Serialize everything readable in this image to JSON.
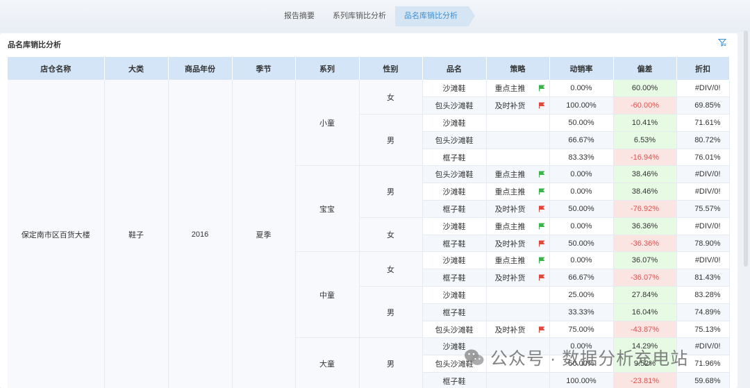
{
  "tabs": [
    {
      "label": "报告摘要",
      "active": false
    },
    {
      "label": "系列库销比分析",
      "active": false
    },
    {
      "label": "品名库销比分析",
      "active": true
    }
  ],
  "panel": {
    "title": "品名库销比分析"
  },
  "columns": [
    "店仓名称",
    "大类",
    "商品年份",
    "季节",
    "系列",
    "性别",
    "品名",
    "策略",
    "动销率",
    "偏差",
    "折扣"
  ],
  "group": {
    "store": "保定南市区百货大楼",
    "category": "鞋子",
    "year": "2016",
    "season": "夏季"
  },
  "series": [
    {
      "name": "小童",
      "genders": [
        {
          "name": "女",
          "rows": [
            {
              "product": "沙滩鞋",
              "strategy": "重点主推",
              "flag": "green",
              "rate": "0.00%",
              "deviation": "60.00%",
              "dev_sign": "pos",
              "discount": "#DIV/0!"
            },
            {
              "product": "包头沙滩鞋",
              "strategy": "及时补货",
              "flag": "red",
              "rate": "100.00%",
              "deviation": "-60.00%",
              "dev_sign": "neg",
              "discount": "69.85%"
            }
          ]
        },
        {
          "name": "男",
          "rows": [
            {
              "product": "沙滩鞋",
              "strategy": "",
              "flag": "",
              "rate": "50.00%",
              "deviation": "10.41%",
              "dev_sign": "pos",
              "discount": "71.61%"
            },
            {
              "product": "包头沙滩鞋",
              "strategy": "",
              "flag": "",
              "rate": "66.67%",
              "deviation": "6.53%",
              "dev_sign": "pos",
              "discount": "80.72%"
            },
            {
              "product": "框子鞋",
              "strategy": "",
              "flag": "",
              "rate": "83.33%",
              "deviation": "-16.94%",
              "dev_sign": "neg",
              "discount": "76.01%"
            }
          ]
        }
      ]
    },
    {
      "name": "宝宝",
      "genders": [
        {
          "name": "男",
          "rows": [
            {
              "product": "包头沙滩鞋",
              "strategy": "重点主推",
              "flag": "green",
              "rate": "0.00%",
              "deviation": "38.46%",
              "dev_sign": "pos",
              "discount": "#DIV/0!"
            },
            {
              "product": "沙滩鞋",
              "strategy": "重点主推",
              "flag": "green",
              "rate": "0.00%",
              "deviation": "38.46%",
              "dev_sign": "pos",
              "discount": "#DIV/0!"
            },
            {
              "product": "框子鞋",
              "strategy": "及时补货",
              "flag": "red",
              "rate": "50.00%",
              "deviation": "-76.92%",
              "dev_sign": "neg",
              "discount": "75.57%"
            }
          ]
        },
        {
          "name": "女",
          "rows": [
            {
              "product": "沙滩鞋",
              "strategy": "重点主推",
              "flag": "green",
              "rate": "0.00%",
              "deviation": "36.36%",
              "dev_sign": "pos",
              "discount": "#DIV/0!"
            },
            {
              "product": "框子鞋",
              "strategy": "及时补货",
              "flag": "red",
              "rate": "50.00%",
              "deviation": "-36.36%",
              "dev_sign": "neg",
              "discount": "78.90%"
            }
          ]
        }
      ]
    },
    {
      "name": "中童",
      "genders": [
        {
          "name": "女",
          "rows": [
            {
              "product": "沙滩鞋",
              "strategy": "重点主推",
              "flag": "green",
              "rate": "0.00%",
              "deviation": "36.07%",
              "dev_sign": "pos",
              "discount": "#DIV/0!"
            },
            {
              "product": "框子鞋",
              "strategy": "及时补货",
              "flag": "red",
              "rate": "66.67%",
              "deviation": "-36.07%",
              "dev_sign": "neg",
              "discount": "81.43%"
            }
          ]
        },
        {
          "name": "男",
          "rows": [
            {
              "product": "沙滩鞋",
              "strategy": "",
              "flag": "",
              "rate": "25.00%",
              "deviation": "27.84%",
              "dev_sign": "pos",
              "discount": "83.28%"
            },
            {
              "product": "框子鞋",
              "strategy": "",
              "flag": "",
              "rate": "33.33%",
              "deviation": "16.04%",
              "dev_sign": "pos",
              "discount": "74.89%"
            },
            {
              "product": "包头沙滩鞋",
              "strategy": "及时补货",
              "flag": "red",
              "rate": "75.00%",
              "deviation": "-43.87%",
              "dev_sign": "neg",
              "discount": "75.13%"
            }
          ]
        }
      ]
    },
    {
      "name": "大童",
      "genders": [
        {
          "name": "男",
          "rows": [
            {
              "product": "沙滩鞋",
              "strategy": "",
              "flag": "",
              "rate": "0.00%",
              "deviation": "14.29%",
              "dev_sign": "pos",
              "discount": "#DIV/0!"
            },
            {
              "product": "包头沙滩鞋",
              "strategy": "",
              "flag": "",
              "rate": "50.00%",
              "deviation": "9.52%",
              "dev_sign": "pos",
              "discount": "71.96%"
            },
            {
              "product": "框子鞋",
              "strategy": "",
              "flag": "",
              "rate": "100.00%",
              "deviation": "-23.81%",
              "dev_sign": "neg",
              "discount": "59.68%"
            }
          ]
        }
      ]
    }
  ],
  "colors": {
    "header": "#d3e5f6",
    "positive": "#e6fae4",
    "negative": "#fbe5e3",
    "flag_green": "#3cb34a",
    "flag_red": "#e0483b",
    "accent": "#3c8fd6"
  },
  "watermark": {
    "text": "公众号 · 数据分析充电站",
    "icon": "wechat-icon"
  }
}
